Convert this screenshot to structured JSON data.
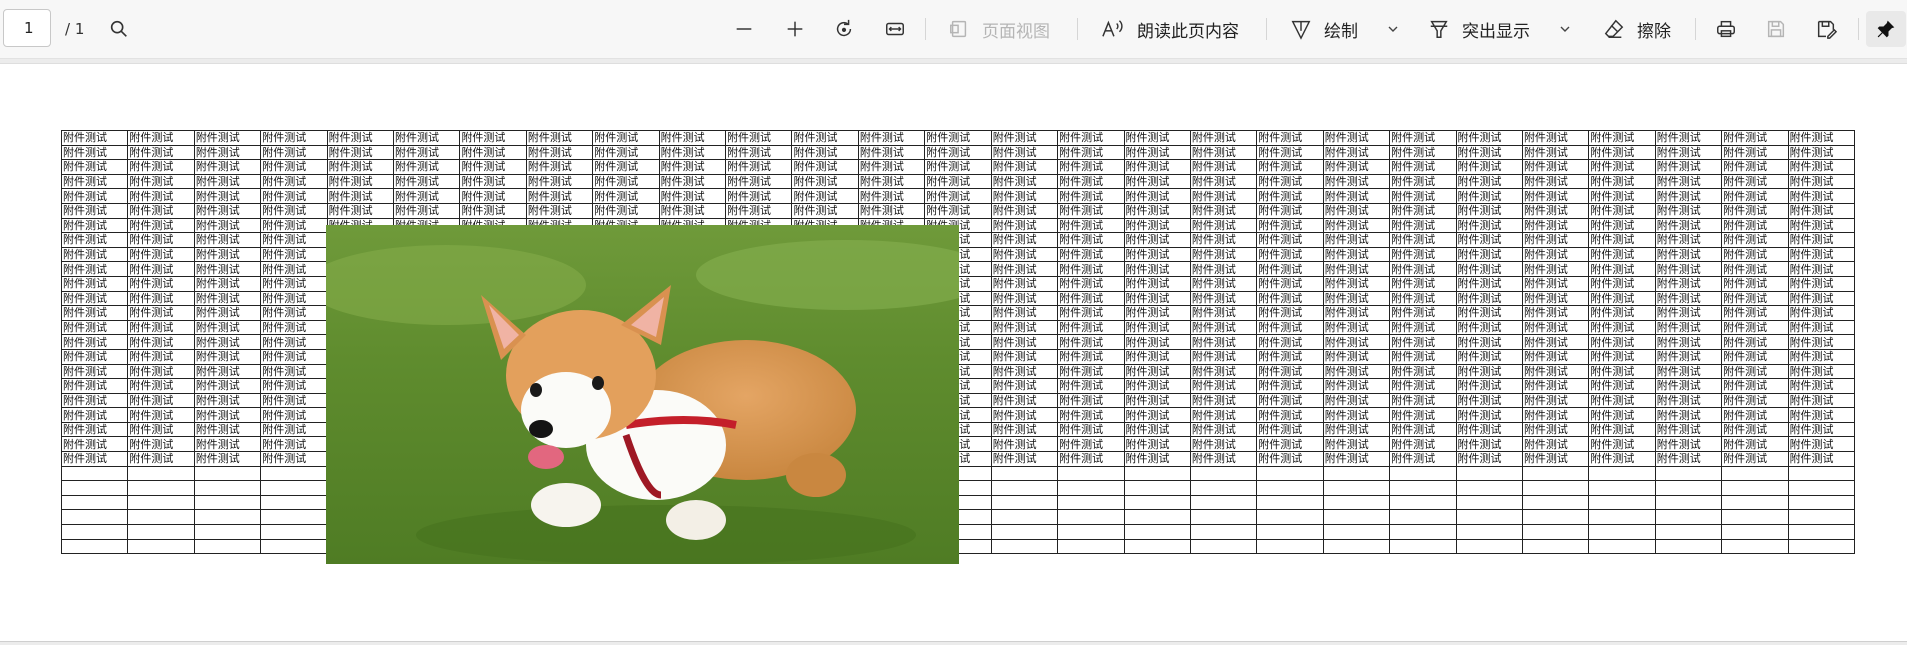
{
  "toolbar": {
    "page_current": "1",
    "page_total": "/ 1",
    "page_view_label": "页面视图",
    "read_aloud_label": "朗读此页内容",
    "draw_label": "绘制",
    "highlight_label": "突出显示",
    "erase_label": "擦除"
  },
  "document": {
    "cell_text": "附件测试",
    "columns": 27,
    "rows": 29,
    "filled_rows": 23,
    "image_alt": "corgi puppy running on grass"
  },
  "colors": {
    "toolbar_bg": "#f7f7f7",
    "page_bg": "#ffffff",
    "grid_line": "#222222",
    "disabled_text": "#b5b5b5"
  },
  "icons": [
    "search-icon",
    "zoom-out-icon",
    "zoom-in-icon",
    "rotate-icon",
    "fit-width-icon",
    "page-view-icon",
    "read-aloud-icon",
    "draw-icon",
    "highlight-icon",
    "erase-icon",
    "print-icon",
    "save-icon",
    "save-as-icon",
    "pin-icon"
  ]
}
